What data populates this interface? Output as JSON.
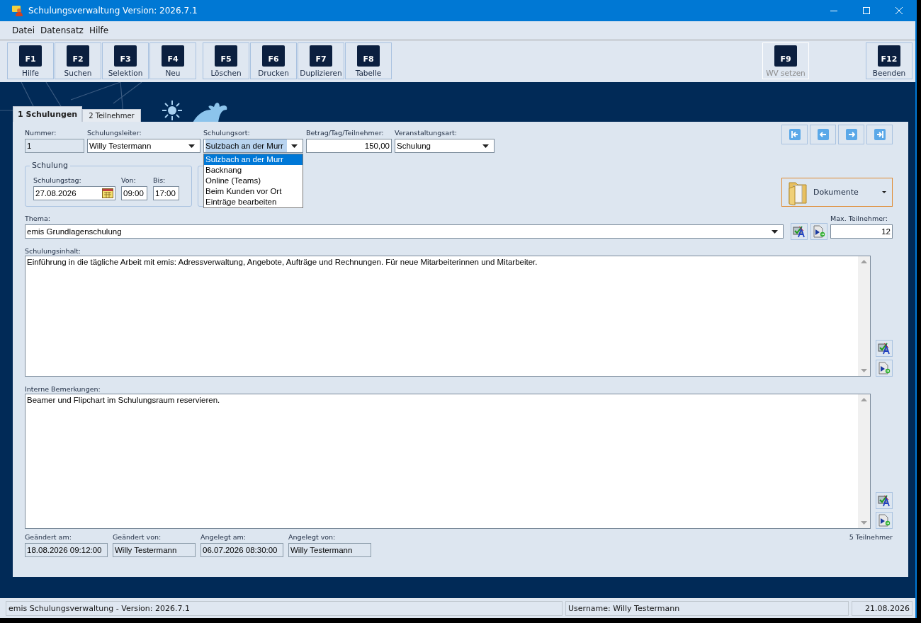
{
  "window": {
    "title": "Schulungsverwaltung Version: 2026.7.1"
  },
  "menu": [
    "Datei",
    "Datensatz",
    "Hilfe"
  ],
  "toolbar": [
    {
      "buttons": [
        {
          "key": "F1",
          "label": "Hilfe",
          "disabled": false
        },
        {
          "key": "F2",
          "label": "Suchen",
          "disabled": false
        },
        {
          "key": "F3",
          "label": "Selektion",
          "disabled": false
        },
        {
          "key": "F4",
          "label": "Neu",
          "disabled": false
        }
      ]
    },
    {
      "buttons": [
        {
          "key": "F5",
          "label": "Löschen",
          "disabled": false
        },
        {
          "key": "F6",
          "label": "Drucken",
          "disabled": false
        },
        {
          "key": "F7",
          "label": "Duplizieren",
          "disabled": false
        },
        {
          "key": "F8",
          "label": "Tabelle",
          "disabled": false
        }
      ]
    },
    {
      "buttons": [
        {
          "key": "F9",
          "label": "WV setzen",
          "disabled": true
        }
      ]
    },
    {
      "buttons": [
        {
          "key": "F12",
          "label": "Beenden",
          "disabled": false
        }
      ]
    }
  ],
  "tabs": [
    {
      "label": "1 Schulungen",
      "selected": true
    },
    {
      "label": "2 Teilnehmer",
      "selected": false
    }
  ],
  "form": {
    "nummer": {
      "label": "Nummer:",
      "value": "1"
    },
    "schulungsleiter": {
      "label": "Schulungsleiter:",
      "value": "Willy Testermann"
    },
    "schulungsort": {
      "label": "Schulungsort:",
      "value": "Sulzbach an der Murr",
      "expanded": true,
      "options": [
        {
          "label": "Sulzbach an der Murr",
          "selected": true
        },
        {
          "label": "Backnang",
          "selected": false
        },
        {
          "label": "Online (Teams)",
          "selected": false
        },
        {
          "label": "Beim Kunden vor Ort",
          "selected": false
        },
        {
          "label": "Einträge bearbeiten",
          "selected": false
        }
      ]
    },
    "betrag": {
      "label": "Betrag/Tag/Teilnehmer:",
      "value": "150,00"
    },
    "veranstaltungsart": {
      "label": "Veranstaltungsart:",
      "value": "Schulung"
    },
    "schulung": {
      "title": "Schulung",
      "schulungstag": {
        "label": "Schulungstag:",
        "value": "27.08.2026"
      },
      "von": {
        "label": "Von:",
        "value": "09:00"
      },
      "bis": {
        "label": "Bis:",
        "value": "17:00"
      }
    },
    "dokumente": {
      "label": "Dokumente"
    },
    "thema": {
      "label": "Thema:",
      "value": "emis Grundlagenschulung"
    },
    "max_teilnehmer": {
      "label": "Max. Teilnehmer:",
      "value": "12"
    },
    "schulungsinhalt": {
      "label": "Schulungsinhalt:",
      "value": "Einführung in die tägliche Arbeit mit emis: Adressverwaltung, Angebote, Aufträge und Rechnungen. Für neue Mitarbeiterinnen und Mitarbeiter."
    },
    "interne_bemerkungen": {
      "label": "Interne Bemerkungen:",
      "value": "Beamer und Flipchart im Schulungsraum reservieren."
    },
    "audit": [
      {
        "label": "Geändert am:",
        "value": "18.08.2026 09:12:00"
      },
      {
        "label": "Geändert von:",
        "value": "Willy Testermann"
      },
      {
        "label": "Angelegt am:",
        "value": "06.07.2026 08:30:00"
      },
      {
        "label": "Angelegt von:",
        "value": "Willy Testermann"
      }
    ],
    "teilnehmer_anzahl": "5 Teilnehmer"
  },
  "status_bar": [
    "emis Schulungsverwaltung - Version: 2026.7.1",
    "Username: Willy Testermann",
    "21.08.2026"
  ]
}
